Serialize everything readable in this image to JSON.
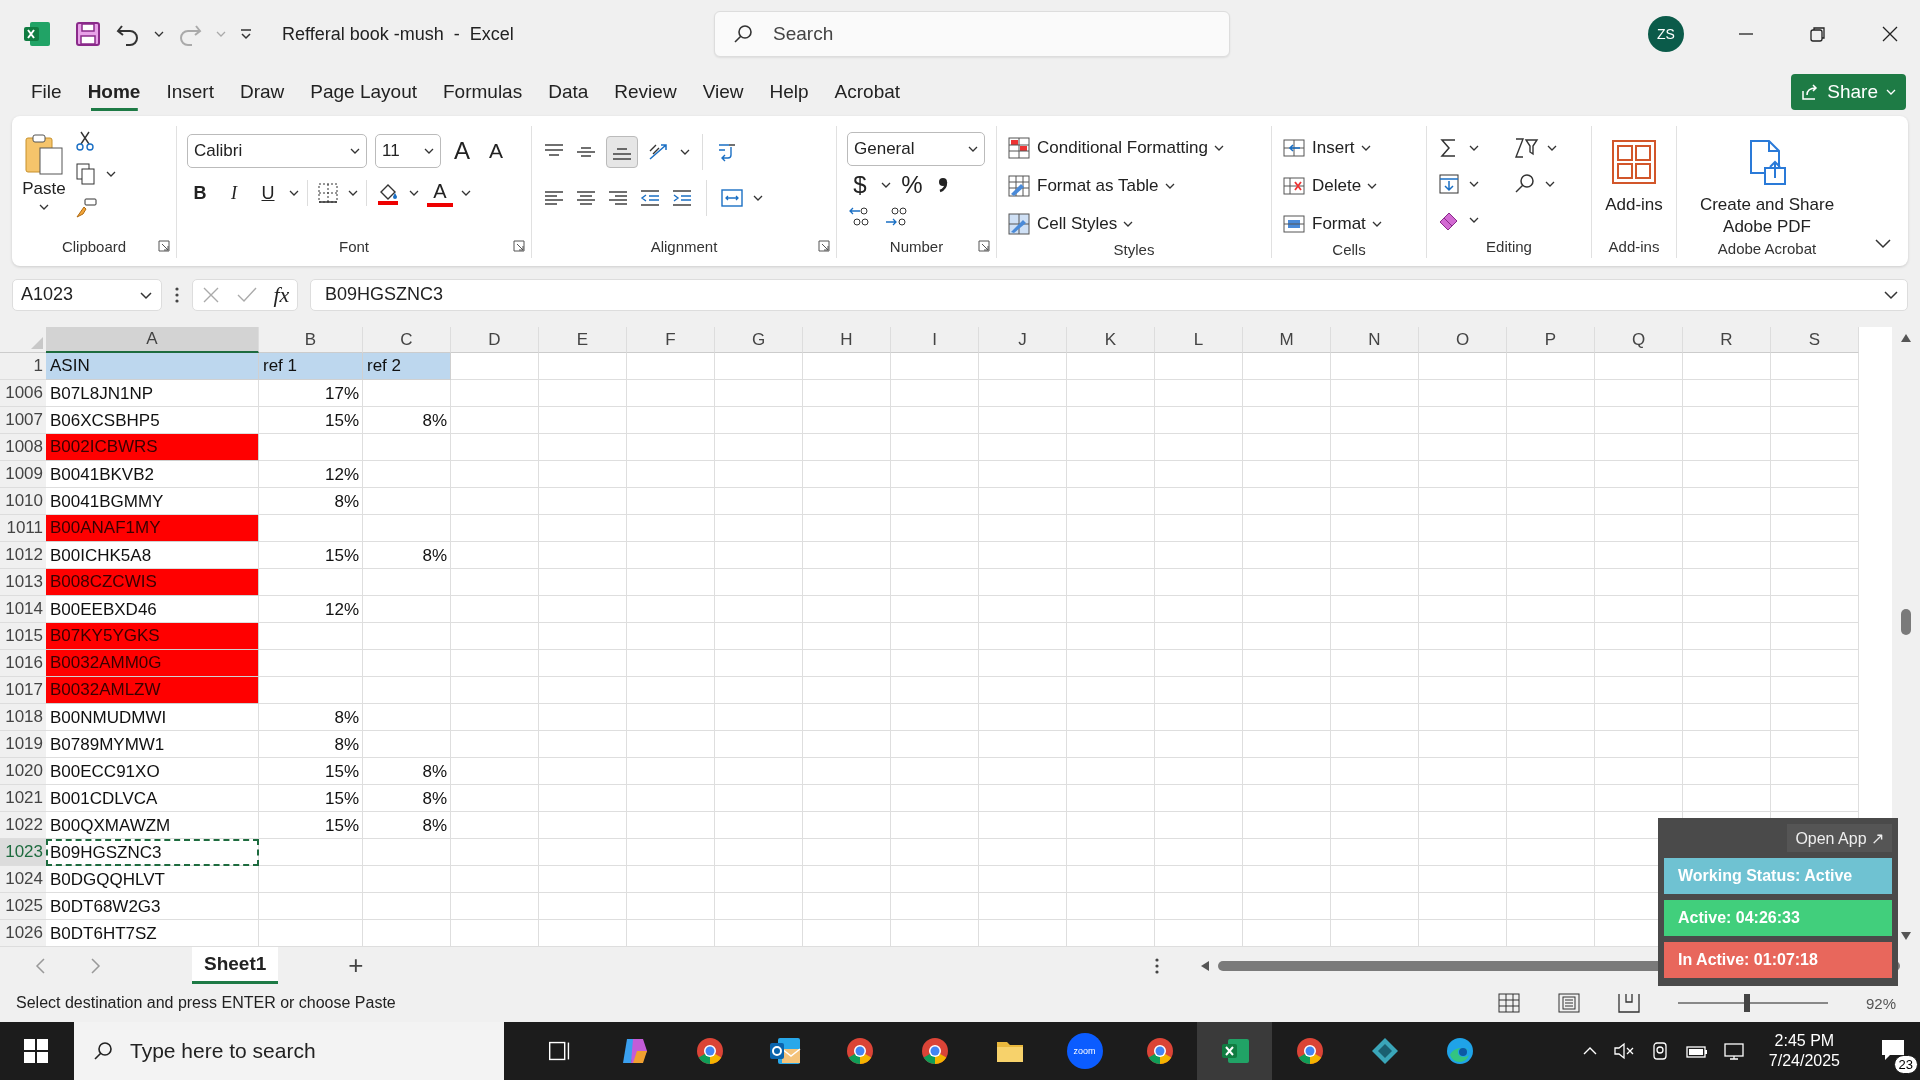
{
  "title_bar": {
    "title": "Refferal book -mush  -  Excel",
    "search_placeholder": "Search",
    "avatar": "ZS"
  },
  "menu_tabs": [
    {
      "label": "File",
      "selected": false
    },
    {
      "label": "Home",
      "selected": true
    },
    {
      "label": "Insert",
      "selected": false
    },
    {
      "label": "Draw",
      "selected": false
    },
    {
      "label": "Page Layout",
      "selected": false
    },
    {
      "label": "Formulas",
      "selected": false
    },
    {
      "label": "Data",
      "selected": false
    },
    {
      "label": "Review",
      "selected": false
    },
    {
      "label": "View",
      "selected": false
    },
    {
      "label": "Help",
      "selected": false
    },
    {
      "label": "Acrobat",
      "selected": false
    }
  ],
  "share_button": "Share",
  "ribbon": {
    "clipboard": {
      "paste": "Paste",
      "label": "Clipboard"
    },
    "font": {
      "name": "Calibri",
      "size": "11",
      "grow": "A",
      "shrink": "A",
      "bold": "B",
      "italic": "I",
      "underline": "U",
      "color_glyph": "A",
      "label": "Font"
    },
    "alignment": {
      "label": "Alignment"
    },
    "number": {
      "format": "General",
      "currency": "$",
      "percent": "%",
      "label": "Number"
    },
    "styles": {
      "items": [
        "Conditional Formatting",
        "Format as Table",
        "Cell Styles"
      ],
      "label": "Styles"
    },
    "cells": {
      "items": [
        "Insert",
        "Delete",
        "Format"
      ],
      "label": "Cells"
    },
    "editing": {
      "label": "Editing"
    },
    "addins": {
      "button": "Add-ins",
      "label": "Add-ins"
    },
    "acrobat": {
      "button": "Create and Share Adobe PDF",
      "label": "Adobe Acrobat"
    }
  },
  "formula_bar": {
    "name_box": "A1023",
    "function_label": "fx",
    "formula": "B09HGSZNC3"
  },
  "sheet": {
    "columns": [
      {
        "label": "A",
        "selected": true
      },
      {
        "label": "B",
        "selected": false
      },
      {
        "label": "C",
        "selected": false
      },
      {
        "label": "D",
        "selected": false
      },
      {
        "label": "E",
        "selected": false
      },
      {
        "label": "F",
        "selected": false
      },
      {
        "label": "G",
        "selected": false
      },
      {
        "label": "H",
        "selected": false
      },
      {
        "label": "I",
        "selected": false
      },
      {
        "label": "J",
        "selected": false
      },
      {
        "label": "K",
        "selected": false
      },
      {
        "label": "L",
        "selected": false
      },
      {
        "label": "M",
        "selected": false
      },
      {
        "label": "N",
        "selected": false
      },
      {
        "label": "O",
        "selected": false
      },
      {
        "label": "P",
        "selected": false
      },
      {
        "label": "Q",
        "selected": false
      },
      {
        "label": "R",
        "selected": false
      },
      {
        "label": "S",
        "selected": false
      }
    ],
    "rows": [
      {
        "number": "1",
        "kind": "header",
        "selected": false,
        "cells": {
          "A": "ASIN",
          "B": "ref 1",
          "C": "ref 2"
        }
      },
      {
        "number": "1006",
        "kind": "plain",
        "selected": false,
        "cells": {
          "A": "B07L8JN1NP",
          "B": "17%"
        }
      },
      {
        "number": "1007",
        "kind": "plain",
        "selected": false,
        "cells": {
          "A": "B06XCSBHP5",
          "B": "15%",
          "C": "8%"
        }
      },
      {
        "number": "1008",
        "kind": "flagged",
        "selected": false,
        "cells": {
          "A": "B002ICBWRS"
        }
      },
      {
        "number": "1009",
        "kind": "plain",
        "selected": false,
        "cells": {
          "A": "B0041BKVB2",
          "B": "12%"
        }
      },
      {
        "number": "1010",
        "kind": "plain",
        "selected": false,
        "cells": {
          "A": "B0041BGMMY",
          "B": "8%"
        }
      },
      {
        "number": "1011",
        "kind": "flagged",
        "selected": false,
        "cells": {
          "A": "B00ANAF1MY"
        }
      },
      {
        "number": "1012",
        "kind": "plain",
        "selected": false,
        "cells": {
          "A": "B00ICHK5A8",
          "B": "15%",
          "C": "8%"
        }
      },
      {
        "number": "1013",
        "kind": "flagged",
        "selected": false,
        "cells": {
          "A": "B008CZCWIS"
        }
      },
      {
        "number": "1014",
        "kind": "plain",
        "selected": false,
        "cells": {
          "A": "B00EEBXD46",
          "B": "12%"
        }
      },
      {
        "number": "1015",
        "kind": "flagged",
        "selected": false,
        "cells": {
          "A": "B07KY5YGKS"
        }
      },
      {
        "number": "1016",
        "kind": "flagged",
        "selected": false,
        "cells": {
          "A": "B0032AMM0G"
        }
      },
      {
        "number": "1017",
        "kind": "flagged",
        "selected": false,
        "cells": {
          "A": "B0032AMLZW"
        }
      },
      {
        "number": "1018",
        "kind": "plain",
        "selected": false,
        "cells": {
          "A": "B00NMUDMWI",
          "B": "8%"
        }
      },
      {
        "number": "1019",
        "kind": "plain",
        "selected": false,
        "cells": {
          "A": "B0789MYMW1",
          "B": "8%"
        }
      },
      {
        "number": "1020",
        "kind": "plain",
        "selected": false,
        "cells": {
          "A": "B00ECC91XO",
          "B": "15%",
          "C": "8%"
        }
      },
      {
        "number": "1021",
        "kind": "plain",
        "selected": false,
        "cells": {
          "A": "B001CDLVCA",
          "B": "15%",
          "C": "8%"
        }
      },
      {
        "number": "1022",
        "kind": "plain",
        "selected": false,
        "cells": {
          "A": "B00QXMAWZM",
          "B": "15%",
          "C": "8%"
        }
      },
      {
        "number": "1023",
        "kind": "plain",
        "selected": true,
        "cells": {
          "A": "B09HGSZNC3"
        }
      },
      {
        "number": "1024",
        "kind": "plain",
        "selected": false,
        "cells": {
          "A": "B0DGQQHLVT"
        }
      },
      {
        "number": "1025",
        "kind": "plain",
        "selected": false,
        "cells": {
          "A": "B0DT68W2G3"
        }
      },
      {
        "number": "1026",
        "kind": "plain",
        "selected": false,
        "cells": {
          "A": "B0DT6HT7SZ"
        }
      }
    ]
  },
  "sheet_tabs": [
    {
      "label": "Sheet1",
      "selected": true
    }
  ],
  "add_sheet": "+",
  "status_bar": {
    "message": "Select destination and press ENTER or choose Paste",
    "zoom_slider": {
      "level": 0.46
    },
    "zoom": "92%"
  },
  "tracker_widget": {
    "open_app": "Open App ↗",
    "lines": [
      {
        "text": "Working Status: Active",
        "color": "#6fc2d2"
      },
      {
        "text": "Active: 04:26:33",
        "color": "#41cf7c"
      },
      {
        "text": "In Active: 01:07:18",
        "color": "#e8675c"
      }
    ]
  },
  "taskbar": {
    "search_placeholder": "Type here to search",
    "apps": [
      {
        "kind": "taskview",
        "selected": false
      },
      {
        "kind": "copilot",
        "selected": false
      },
      {
        "kind": "chrome",
        "selected": false
      },
      {
        "kind": "outlook",
        "selected": false
      },
      {
        "kind": "chrome",
        "selected": false
      },
      {
        "kind": "chrome",
        "selected": false
      },
      {
        "kind": "files",
        "selected": false
      },
      {
        "kind": "zoom",
        "label": "zoom",
        "selected": false
      },
      {
        "kind": "chrome",
        "selected": false
      },
      {
        "kind": "excel",
        "selected": true
      },
      {
        "kind": "chrome",
        "selected": false
      },
      {
        "kind": "diamond",
        "selected": false
      },
      {
        "kind": "edge",
        "selected": false
      }
    ],
    "time": "2:45 PM",
    "date": "7/24/2025",
    "notifications": "23"
  }
}
